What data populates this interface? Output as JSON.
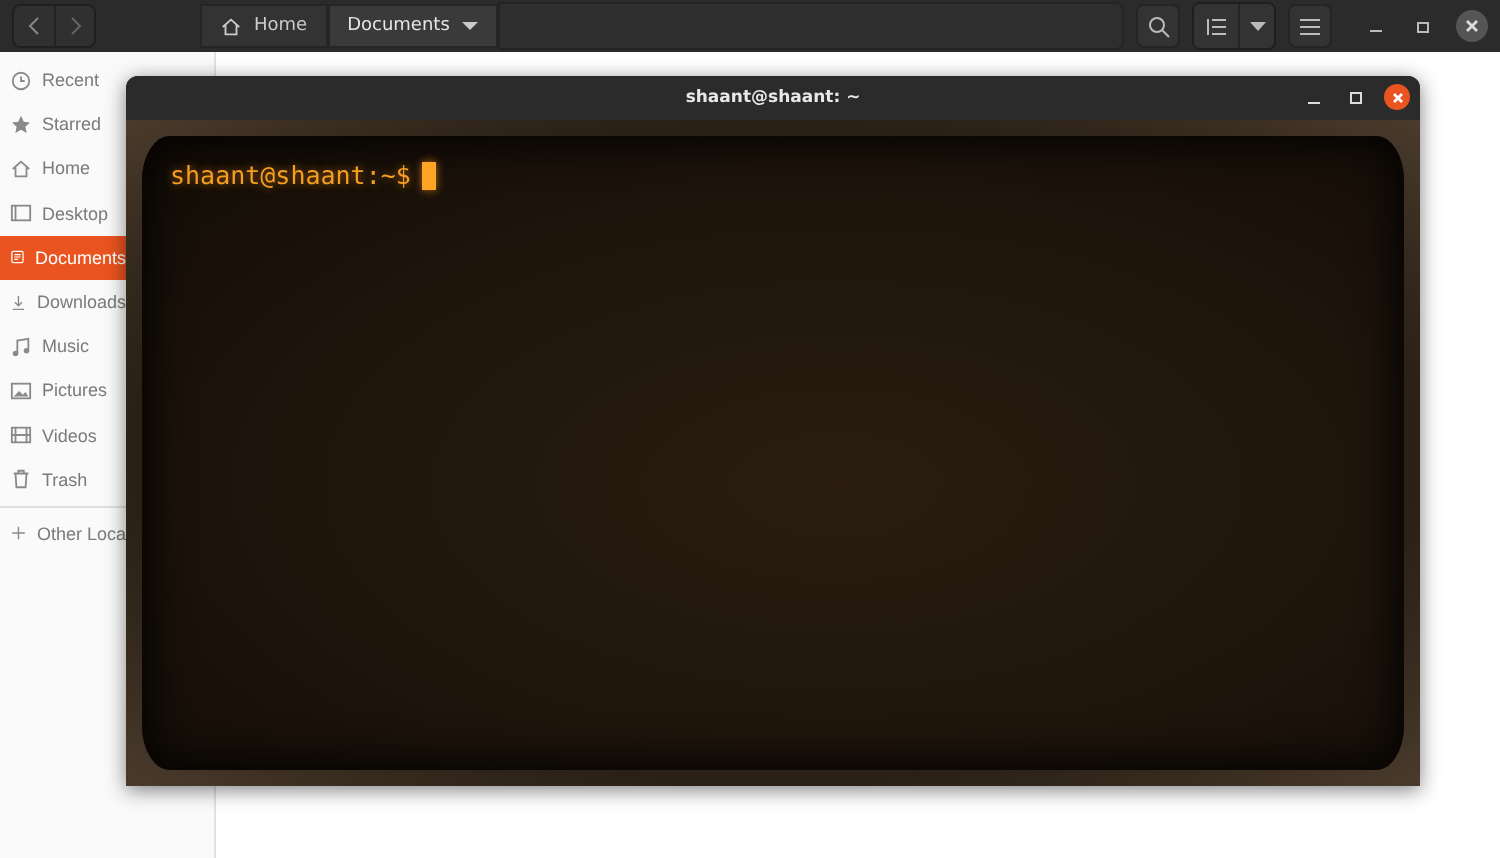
{
  "file_manager": {
    "path": [
      {
        "label": "Home",
        "selected": false
      },
      {
        "label": "Documents",
        "selected": true
      }
    ],
    "sidebar": [
      {
        "label": "Recent",
        "selected": false
      },
      {
        "label": "Starred",
        "selected": false
      },
      {
        "label": "Home",
        "selected": false
      },
      {
        "label": "Desktop",
        "selected": false
      },
      {
        "label": "Documents",
        "selected": true
      },
      {
        "label": "Downloads",
        "selected": false
      },
      {
        "label": "Music",
        "selected": false
      },
      {
        "label": "Pictures",
        "selected": false
      },
      {
        "label": "Videos",
        "selected": false
      },
      {
        "label": "Trash",
        "selected": false
      },
      {
        "label": "Other Loca",
        "selected": false
      }
    ]
  },
  "terminal": {
    "title": "shaant@shaant: ~",
    "prompt": "shaant@shaant:~$"
  }
}
